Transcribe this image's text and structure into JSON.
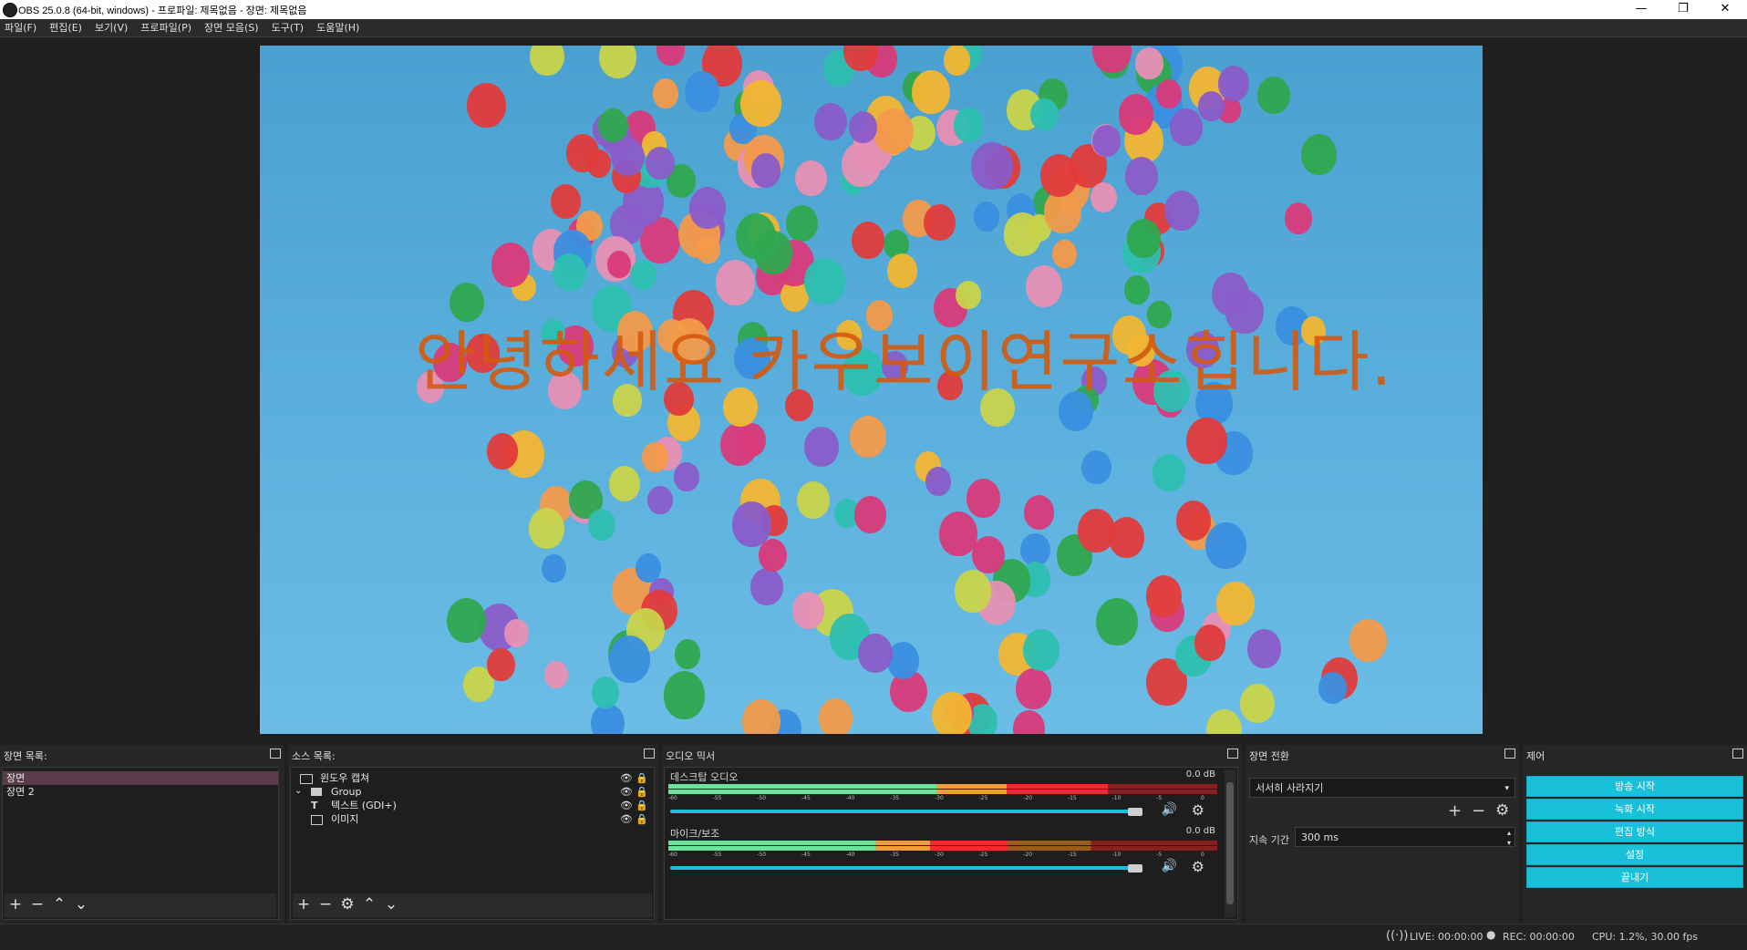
{
  "window": {
    "title": "OBS 25.0.8 (64-bit, windows) - 프로파일: 제목없음 - 장면: 제목없음",
    "minimize": "—",
    "restore": "❐",
    "close": "✕"
  },
  "menu": [
    "파일(F)",
    "편집(E)",
    "보기(V)",
    "프로파일(P)",
    "장면 모음(S)",
    "도구(T)",
    "도움말(H)"
  ],
  "preview": {
    "overlay_text": "안녕하세요 카우보이연구소힙니다."
  },
  "scenes": {
    "title": "장면 목록:",
    "items": [
      "장면",
      "장면 2"
    ],
    "selected_index": 0
  },
  "sources": {
    "title": "소스 목록:",
    "items": [
      {
        "label": "윈도우 캡쳐",
        "icon": "window-icon"
      },
      {
        "label": "Group",
        "icon": "folder-icon"
      },
      {
        "label": "텍스트 (GDI+)",
        "icon": "text-icon"
      },
      {
        "label": "이미지",
        "icon": "image-icon"
      }
    ]
  },
  "mixer": {
    "title": "오디오 믹서",
    "ticks": [
      "-60",
      "-55",
      "-50",
      "-45",
      "-40",
      "-35",
      "-30",
      "-25",
      "-20",
      "-15",
      "-10",
      "-5",
      "0"
    ],
    "channels": [
      {
        "name": "데스크탑 오디오",
        "db": "0.0 dB",
        "level": 0.8,
        "volume": 1.0
      },
      {
        "name": "마이크/보조",
        "db": "0.0 dB",
        "level": 0.62,
        "volume": 1.0
      }
    ]
  },
  "transitions": {
    "title": "장면 전환",
    "selected": "서서히 사라지기",
    "duration_label": "지속 기간",
    "duration_value": "300 ms"
  },
  "controls": {
    "title": "제어",
    "buttons": [
      "방송 시작",
      "녹화 시작",
      "편집 방식",
      "설정",
      "끝내기"
    ]
  },
  "status": {
    "live": "LIVE: 00:00:00",
    "rec": "REC: 00:00:00",
    "cpu": "CPU: 1.2%, 30.00 fps"
  },
  "colors": {
    "accent": "#18c0da",
    "scene_selected": "#5a3b4a",
    "overlay_text": "#d45a10"
  }
}
